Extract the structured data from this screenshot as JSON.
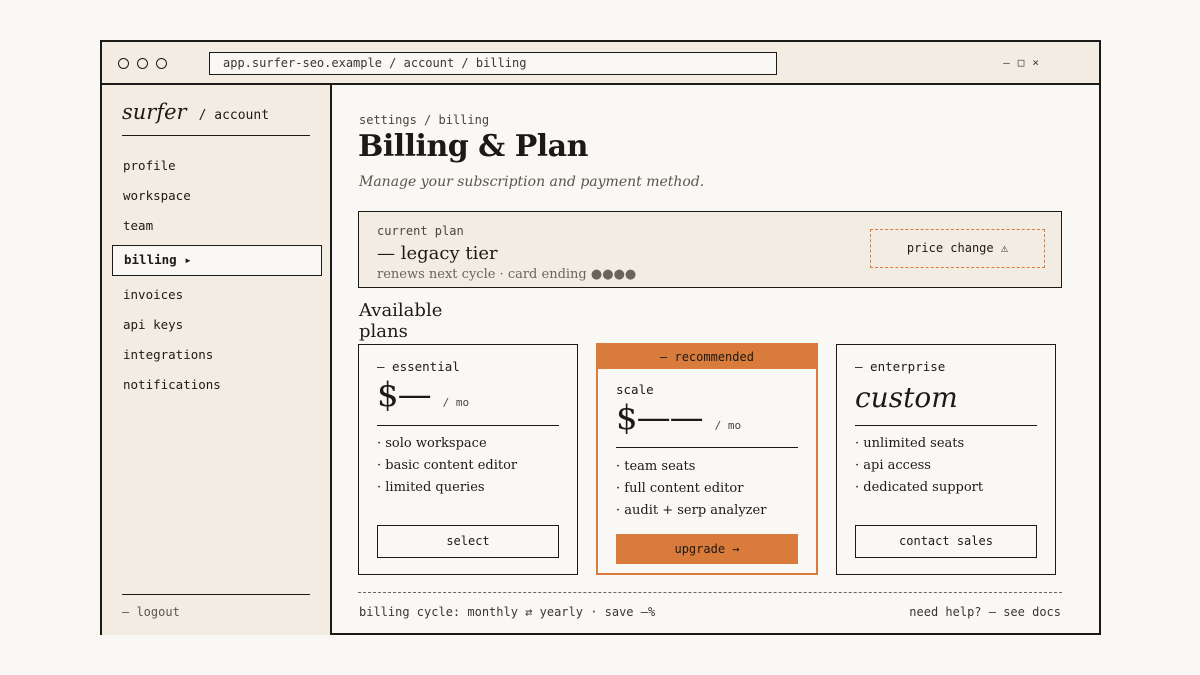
{
  "window": {
    "url": "app.surfer-seo.example / account / billing",
    "controls": {
      "minimize": "—",
      "maximize": "□",
      "close": "×"
    }
  },
  "sidebar": {
    "brand": "surfer",
    "section": "/ account",
    "items": [
      {
        "label": "profile"
      },
      {
        "label": "workspace"
      },
      {
        "label": "team"
      },
      {
        "label": "billing ▸",
        "active": true
      },
      {
        "label": "invoices"
      },
      {
        "label": "api keys"
      },
      {
        "label": "integrations"
      },
      {
        "label": "notifications"
      }
    ],
    "logout": "— logout"
  },
  "main": {
    "breadcrumb": "settings / billing",
    "title": "Billing & Plan",
    "subtitle": "Manage your subscription and payment method.",
    "current_plan": {
      "label": "current plan",
      "tier": "— legacy tier",
      "meta": "renews next cycle · card ending ●●●●",
      "badge": "price change ⚠"
    },
    "available_heading": "Available plans",
    "plans": [
      {
        "name": "— essential",
        "price": "$—",
        "per": "/ mo",
        "features": [
          "· solo workspace",
          "· basic content editor",
          "· limited queries"
        ],
        "button": "select"
      },
      {
        "banner": "— recommended",
        "name": "scale",
        "price": "$——",
        "per": "/ mo",
        "features": [
          "· team seats",
          "· full content editor",
          "· audit + serp analyzer"
        ],
        "button": "upgrade →"
      },
      {
        "name": "— enterprise",
        "price": "custom",
        "features": [
          "· unlimited seats",
          "· api access",
          "· dedicated support"
        ],
        "button": "contact sales"
      }
    ],
    "footer": {
      "cycle": "billing cycle: monthly ⇄ yearly · save —%",
      "help": "need help? — see docs"
    }
  },
  "colors": {
    "accent": "#d97b3a",
    "panel": "#f3ece2",
    "ink": "#1c1a17",
    "paper": "#faf8f4"
  }
}
